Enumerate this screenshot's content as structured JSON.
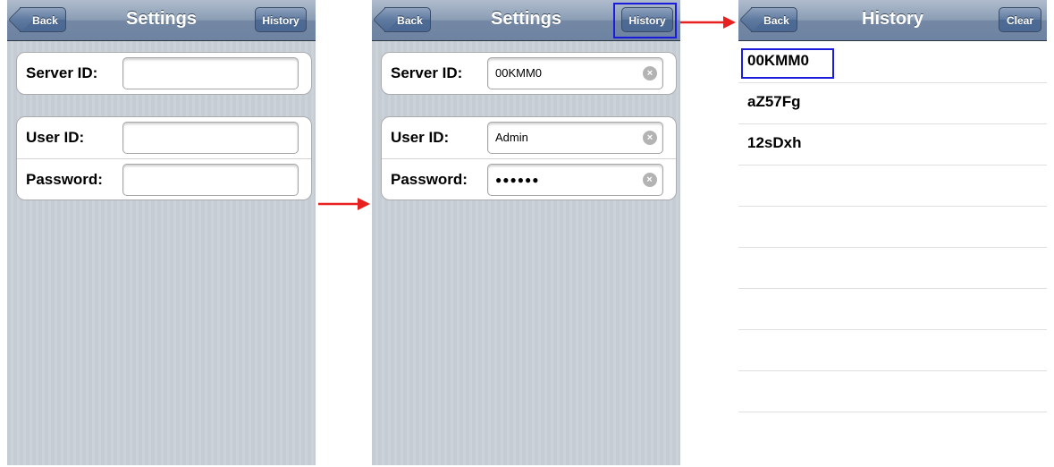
{
  "panel1": {
    "nav": {
      "back": "Back",
      "title": "Settings",
      "history": "History"
    },
    "server_label": "Server ID:",
    "user_label": "User ID:",
    "password_label": "Password:",
    "server_value": "",
    "user_value": "",
    "password_value": ""
  },
  "panel2": {
    "nav": {
      "back": "Back",
      "title": "Settings",
      "history": "History"
    },
    "server_label": "Server ID:",
    "user_label": "User ID:",
    "password_label": "Password:",
    "server_value": "00KMM0",
    "user_value": "Admin",
    "password_value": "●●●●●●"
  },
  "panel3": {
    "nav": {
      "back": "Back",
      "title": "History",
      "clear": "Clear"
    },
    "items": [
      "00KMM0",
      "aZ57Fg",
      "12sDxh",
      "",
      "",
      "",
      "",
      "",
      ""
    ]
  },
  "colors": {
    "arrow": "#e8201f",
    "highlight": "#1b1bdc"
  },
  "icons": {
    "clear_field": "clear-circle-icon",
    "arrow": "right-arrow-icon"
  }
}
